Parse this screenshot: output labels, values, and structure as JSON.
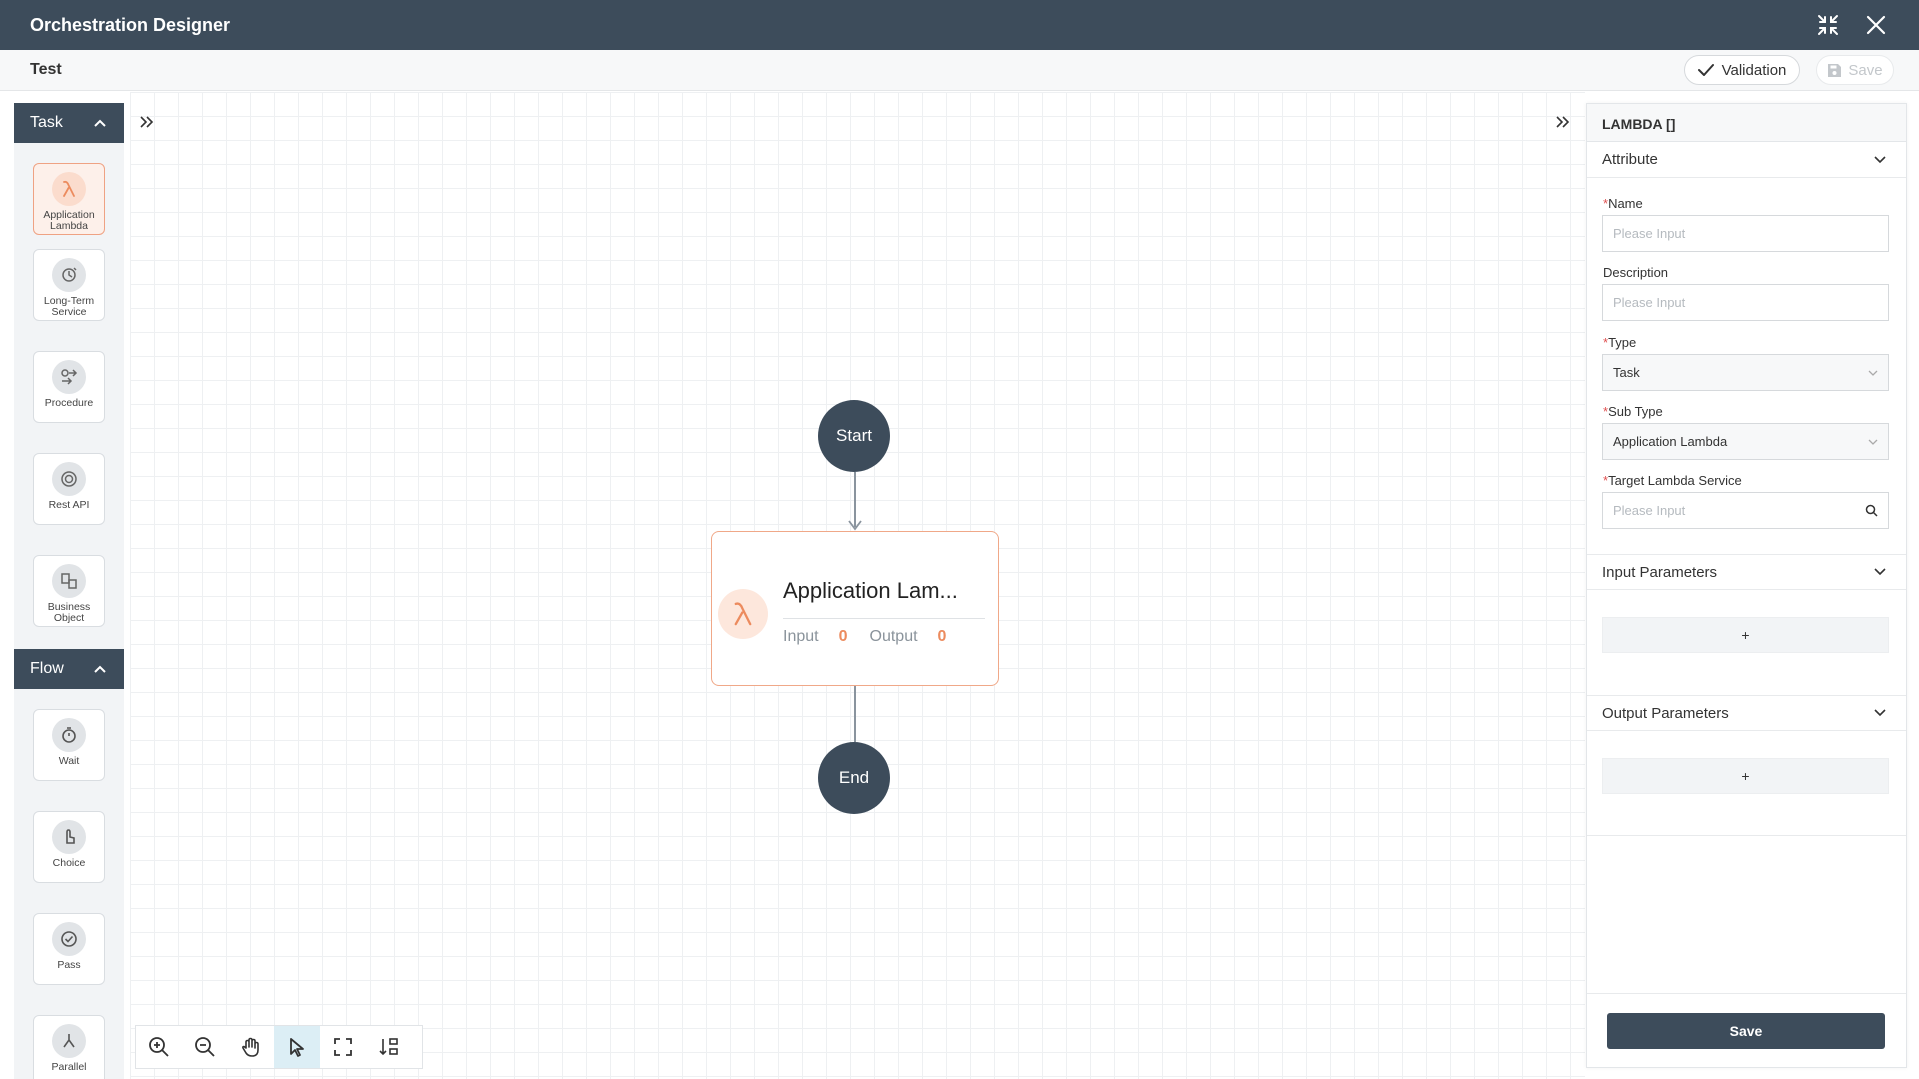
{
  "window": {
    "title": "Orchestration Designer"
  },
  "header": {
    "title": "Test",
    "validation_label": "Validation",
    "save_label": "Save"
  },
  "palette": {
    "task_section": "Task",
    "task_items": [
      {
        "label": "Application Lambda",
        "icon": "lambda-icon"
      },
      {
        "label": "Long-Term Service",
        "icon": "long-term-service-icon"
      },
      {
        "label": "Procedure",
        "icon": "procedure-icon"
      },
      {
        "label": "Rest API",
        "icon": "api-icon"
      },
      {
        "label": "Business Object",
        "icon": "business-object-icon"
      }
    ],
    "flow_section": "Flow",
    "flow_items": [
      {
        "label": "Wait",
        "icon": "timer-icon"
      },
      {
        "label": "Choice",
        "icon": "choice-icon"
      },
      {
        "label": "Pass",
        "icon": "check-circle-icon"
      },
      {
        "label": "Parallel",
        "icon": "parallel-icon"
      }
    ]
  },
  "flow": {
    "start_label": "Start",
    "end_label": "End",
    "task_node": {
      "title": "Application Lam...",
      "input_label": "Input",
      "input_count": "0",
      "output_label": "Output",
      "output_count": "0"
    }
  },
  "toolbar": {
    "tools": [
      "zoom-in",
      "zoom-out",
      "pan",
      "select",
      "fit-screen",
      "auto-layout"
    ],
    "selected": "select"
  },
  "panel": {
    "title": "LAMBDA []",
    "attribute_section": "Attribute",
    "fields": {
      "name": {
        "label": "Name",
        "required": "*",
        "placeholder": "Please Input"
      },
      "description": {
        "label": "Description",
        "placeholder": "Please Input"
      },
      "type": {
        "label": "Type",
        "required": "*",
        "value": "Task"
      },
      "sub_type": {
        "label": "Sub Type",
        "required": "*",
        "value": "Application Lambda"
      },
      "target": {
        "label": "Target Lambda Service",
        "required": "*",
        "placeholder": "Please Input"
      }
    },
    "input_params_section": "Input Parameters",
    "output_params_section": "Output Parameters",
    "add_label": "+",
    "save_label": "Save"
  },
  "colors": {
    "header_bg": "#3d4c5b",
    "accent_orange": "#ec8b5e",
    "canvas_grid": "#eef0f2"
  }
}
